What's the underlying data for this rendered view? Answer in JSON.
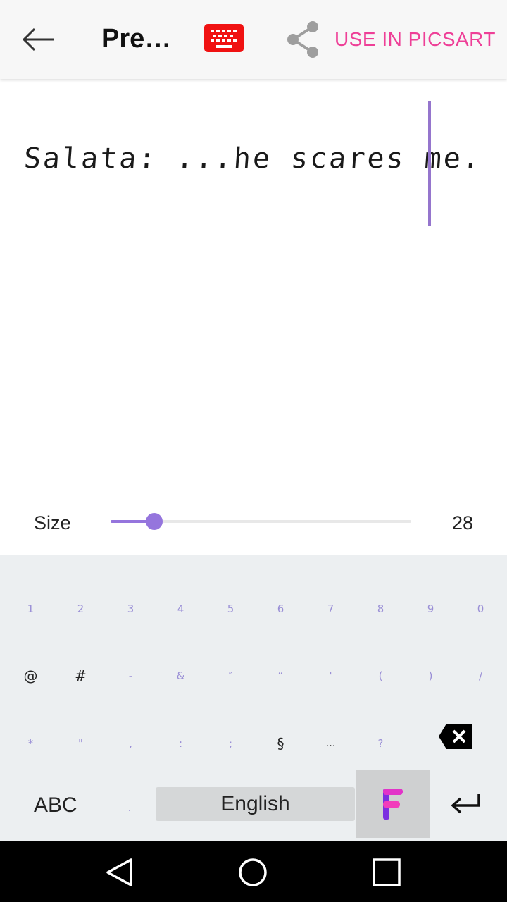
{
  "header": {
    "title": "Pre…",
    "use_button_label": "USE IN PICSART",
    "icons": {
      "back": "back-arrow-icon",
      "keyboard": "keyboard-icon",
      "share": "share-icon"
    },
    "colors": {
      "accent_pink": "#ee3f97",
      "keyboard_icon_red": "#f01212"
    }
  },
  "preview": {
    "text": "Salata: ...he scares me.",
    "cursor_color": "#9575cd"
  },
  "size_control": {
    "label": "Size",
    "value": "28",
    "slider_fraction": 0.145,
    "accent_color": "#9575dd"
  },
  "keyboard": {
    "row1": [
      "1",
      "2",
      "3",
      "4",
      "5",
      "6",
      "7",
      "8",
      "9",
      "0"
    ],
    "row2": [
      "@",
      "#",
      "-",
      "&",
      "″",
      "“",
      "'",
      "(",
      ")",
      "/"
    ],
    "row3": [
      "*",
      "\"",
      ",",
      ":",
      ";",
      "§",
      "…",
      "?"
    ],
    "abc_label": "ABC",
    "dot_label": ".",
    "space_label": "English",
    "font_key_icon": "font-f-logo-icon",
    "backspace_icon": "backspace-icon",
    "enter_icon": "enter-icon"
  },
  "navbar": {
    "icons": [
      "nav-back-icon",
      "nav-home-icon",
      "nav-recents-icon"
    ]
  }
}
